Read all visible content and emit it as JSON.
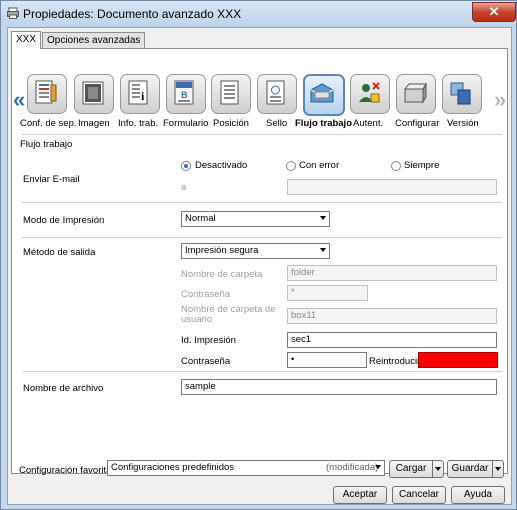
{
  "window": {
    "title": "Propiedades: Documento avanzado XXX",
    "close_label": "✕"
  },
  "tabs": [
    {
      "label": "XXX"
    },
    {
      "label": "Opciones avanzadas"
    }
  ],
  "toolbar": {
    "items": [
      {
        "label": "Conf. de sep.",
        "icon": "layout-icon"
      },
      {
        "label": "Imagen",
        "icon": "image-icon"
      },
      {
        "label": "Info. trab.",
        "icon": "info-icon"
      },
      {
        "label": "Formulario",
        "icon": "form-icon"
      },
      {
        "label": "Posición",
        "icon": "position-icon"
      },
      {
        "label": "Sello",
        "icon": "stamp-icon"
      },
      {
        "label": "Flujo trabajo",
        "icon": "workflow-icon"
      },
      {
        "label": "Autent.",
        "icon": "auth-icon"
      },
      {
        "label": "Configurar",
        "icon": "configure-icon"
      },
      {
        "label": "Versión",
        "icon": "version-icon"
      }
    ],
    "selected_index": 6,
    "prev_arrow": "«",
    "next_arrow": "»"
  },
  "section_title": "Flujo trabajo",
  "email": {
    "label": "Enviar E-mail",
    "options": [
      "Desactivado",
      "Con error",
      "Siempre"
    ],
    "selected": "Desactivado",
    "to_label": "a",
    "to_value": ""
  },
  "print_mode": {
    "label": "Modo de Impresión",
    "value": "Normal"
  },
  "output": {
    "label": "Método de salida",
    "value": "Impresión segura",
    "folder_name_label": "Nombre de carpeta",
    "folder_name_value": "folder",
    "password_label": "Contraseña",
    "password_value": "*",
    "user_folder_label": "Nombre de carpeta de usuario",
    "user_folder_value": "box11",
    "print_id_label": "Id. Impresión",
    "print_id_value": "sec1",
    "secure_password_label": "Contraseña",
    "secure_password_value": "•",
    "reenter_label": "Reintroducir",
    "reenter_value": ""
  },
  "file_name": {
    "label": "Nombre de archivo",
    "value": "sample"
  },
  "favorites": {
    "label": "Configuración favorita",
    "value": "Configuraciones predefinidos",
    "modified": "(modificada)",
    "load_label": "Cargar",
    "save_label": "Guardar"
  },
  "footer": {
    "ok_label": "Aceptar",
    "cancel_label": "Cancelar",
    "help_label": "Ayuda"
  },
  "colors": {
    "error_field": "#ff0000",
    "selected_border": "#5a86b8"
  }
}
